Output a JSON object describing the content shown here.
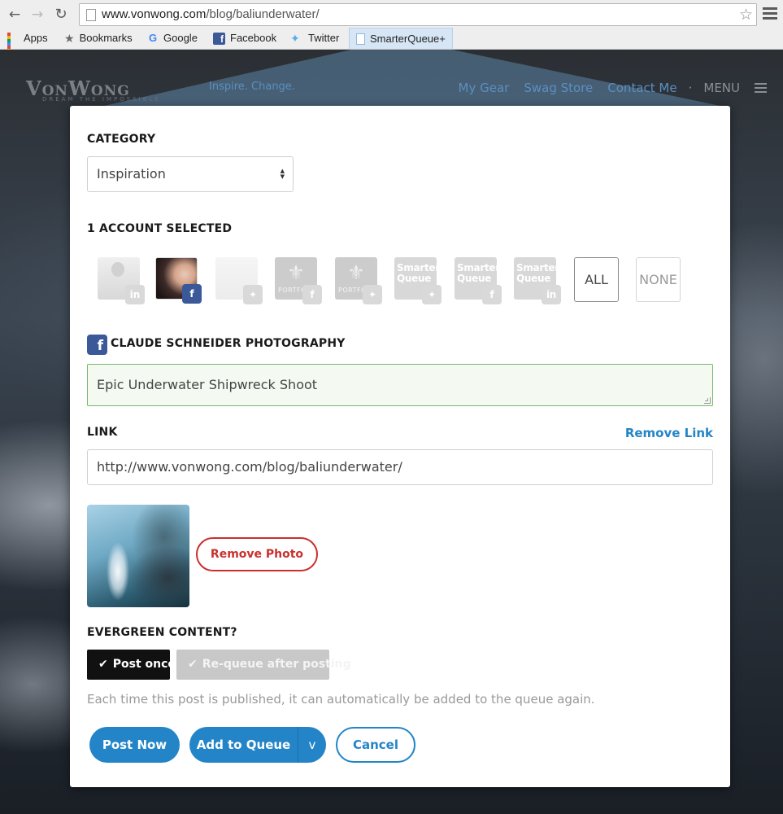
{
  "browser": {
    "url_host": "www.vonwong.com",
    "url_path": "/blog/baliunderwater/",
    "bookmarks": [
      "Apps",
      "Bookmarks",
      "Google",
      "Facebook",
      "Twitter",
      "SmarterQueue+"
    ]
  },
  "site": {
    "logo": "VonWong",
    "logo_sub": "DREAM THE IMPOSSIBLE",
    "tagline": "Inspire. Change.",
    "nav": [
      "My Gear",
      "Swag Store",
      "Contact Me"
    ],
    "menu_label": "MENU"
  },
  "modal": {
    "category_label": "CATEGORY",
    "category_value": "Inspiration",
    "accounts_label": "1 ACCOUNT SELECTED",
    "accounts": [
      {
        "type": "photo",
        "network": "linkedin",
        "badge": "in",
        "selected": false
      },
      {
        "type": "photo",
        "network": "facebook",
        "badge": "f",
        "selected": true
      },
      {
        "type": "photo",
        "network": "twitter",
        "badge": "t",
        "selected": false
      },
      {
        "type": "portfolio",
        "text": "PORTFO",
        "network": "facebook",
        "badge": "f",
        "selected": false
      },
      {
        "type": "portfolio",
        "text": "PORTFO",
        "network": "twitter",
        "badge": "t",
        "selected": false
      },
      {
        "type": "smarterqueue",
        "text1": "Smarter",
        "text2": "Queue",
        "network": "twitter",
        "badge": "t",
        "selected": false
      },
      {
        "type": "smarterqueue",
        "text1": "Smarter",
        "text2": "Queue",
        "network": "facebook",
        "badge": "f",
        "selected": false
      },
      {
        "type": "smarterqueue",
        "text1": "Smarter",
        "text2": "Queue",
        "network": "linkedin",
        "badge": "in",
        "selected": false
      }
    ],
    "all_label": "ALL",
    "none_label": "NONE",
    "account_name": "CLAUDE SCHNEIDER PHOTOGRAPHY",
    "post_text": "Epic Underwater Shipwreck Shoot",
    "link_label": "LINK",
    "remove_link": "Remove Link",
    "link_value": "http://www.vonwong.com/blog/baliunderwater/",
    "remove_photo": "Remove Photo",
    "evergreen_label": "EVERGREEN CONTENT?",
    "post_once": "Post once",
    "requeue": "Re-queue after posting",
    "helper": "Each time this post is published, it can automatically be added to the queue again.",
    "post_now": "Post Now",
    "add_to_queue": "Add to Queue",
    "queue_caret": "v",
    "cancel": "Cancel"
  },
  "colors": {
    "primary": "#2385c7",
    "danger": "#c9302c",
    "facebook": "#3b5998",
    "success_border": "#73b96a"
  }
}
